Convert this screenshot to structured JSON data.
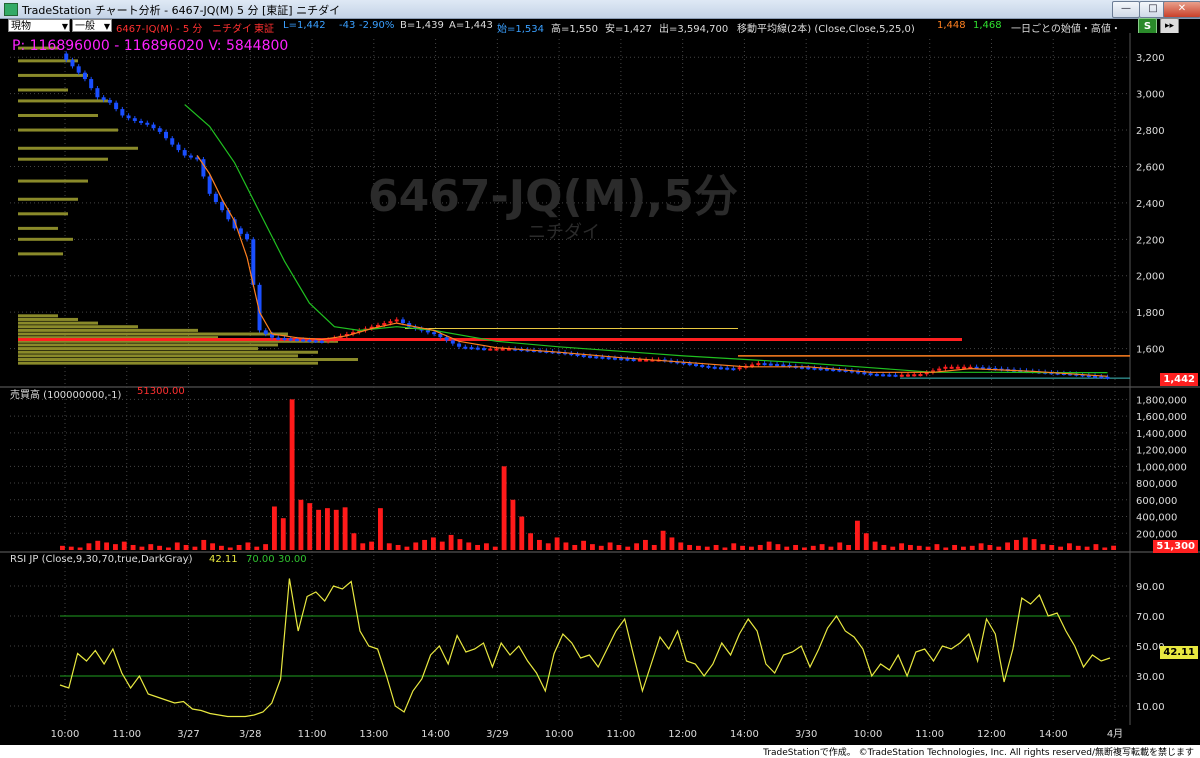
{
  "window": {
    "title": "TradeStation チャート分析 - 6467-JQ(M) 5 分 [東証] ニチダイ",
    "buttons": {
      "minimize": "—",
      "maximize": "□",
      "close": "✕"
    }
  },
  "toolbar": {
    "mode_select": "現物",
    "type_select": "一般",
    "symbol": "6467-JQ(M) - 5 分",
    "company": "ニチダイ",
    "exchange": "東証",
    "last_label": "L=1,442",
    "change": "-43",
    "change_pct": "-2.90%",
    "bid": "B=1,439",
    "ask": "A=1,443",
    "open": "始=1,534",
    "high": "高=1,550",
    "low": "安=1,427",
    "volume": "出=3,594,700",
    "ma_label": "移動平均線(2本) (Close,Close,5,25,0)",
    "ma_fast": "1,448",
    "ma_slow": "1,468",
    "extra": "一日ごとの始値・高値・オ"
  },
  "badges": {
    "s_badge": "S",
    "more_icon": "more-icon"
  },
  "main_panel": {
    "watermark_symbol": "6467-JQ(M),5分",
    "watermark_name": "ニチダイ",
    "cursor_info": "P: 116896000 - 116896020 V: 5844800",
    "last_price_tag": "1,442"
  },
  "volume_panel": {
    "label": "売買高 (100000000,-1)",
    "value": "51300.00",
    "last_value_tag": "51,300"
  },
  "rsi_panel": {
    "label": "RSI JP (Close,9,30,70,true,DarkGray)",
    "value": "42.11",
    "upper": "70.00",
    "lower": "30.00",
    "last_value_tag": "42.11"
  },
  "footer": {
    "copyright": "TradeStationで作成。 ©TradeStation Technologies, Inc. All rights reserved/無断複写転載を禁じます"
  },
  "colors": {
    "up": "#ff2020",
    "down": "#1a4fff",
    "ma_fast": "#ff8020",
    "ma_slow": "#20c020",
    "rsi": "#e8e840",
    "grid": "#444444",
    "volume_bar": "#ff1a1a",
    "volume_profile": "#8a8a2a"
  },
  "chart_data": [
    {
      "type": "candlestick",
      "title": "6467-JQ(M),5分",
      "ylim": [
        1400,
        3300
      ],
      "y_ticks": [
        1600,
        1800,
        2000,
        2200,
        2400,
        2600,
        2800,
        3000,
        3200
      ],
      "x_tick_labels": [
        "10:00",
        "11:00",
        "3/27",
        "3/28",
        "11:00",
        "13:00",
        "14:00",
        "3/29",
        "10:00",
        "11:00",
        "12:00",
        "14:00",
        "3/30",
        "10:00",
        "11:00",
        "12:00",
        "14:00",
        "4月"
      ],
      "close_path": [
        [
          0,
          3220
        ],
        [
          2,
          3150
        ],
        [
          4,
          3080
        ],
        [
          6,
          2980
        ],
        [
          8,
          2950
        ],
        [
          10,
          2880
        ],
        [
          12,
          2850
        ],
        [
          14,
          2830
        ],
        [
          16,
          2790
        ],
        [
          18,
          2720
        ],
        [
          20,
          2660
        ],
        [
          22,
          2640
        ],
        [
          24,
          2450
        ],
        [
          26,
          2360
        ],
        [
          28,
          2260
        ],
        [
          30,
          2200
        ],
        [
          32,
          1700
        ],
        [
          34,
          1660
        ],
        [
          38,
          1650
        ],
        [
          42,
          1640
        ],
        [
          46,
          1680
        ],
        [
          50,
          1720
        ],
        [
          54,
          1760
        ],
        [
          56,
          1720
        ],
        [
          60,
          1680
        ],
        [
          64,
          1610
        ],
        [
          68,
          1600
        ],
        [
          72,
          1600
        ],
        [
          76,
          1590
        ],
        [
          80,
          1580
        ],
        [
          84,
          1560
        ],
        [
          88,
          1550
        ],
        [
          92,
          1540
        ],
        [
          96,
          1540
        ],
        [
          100,
          1520
        ],
        [
          104,
          1500
        ],
        [
          108,
          1490
        ],
        [
          112,
          1520
        ],
        [
          116,
          1510
        ],
        [
          118,
          1500
        ],
        [
          122,
          1490
        ],
        [
          126,
          1480
        ],
        [
          130,
          1460
        ],
        [
          134,
          1455
        ],
        [
          138,
          1460
        ],
        [
          142,
          1500
        ],
        [
          146,
          1500
        ],
        [
          150,
          1490
        ],
        [
          154,
          1480
        ],
        [
          158,
          1470
        ],
        [
          162,
          1462
        ],
        [
          166,
          1448
        ],
        [
          168,
          1442
        ]
      ],
      "ma_fast_path": [
        [
          22,
          2660
        ],
        [
          24,
          2560
        ],
        [
          26,
          2420
        ],
        [
          28,
          2300
        ],
        [
          30,
          2100
        ],
        [
          32,
          1800
        ],
        [
          34,
          1680
        ],
        [
          38,
          1660
        ],
        [
          42,
          1650
        ],
        [
          46,
          1670
        ],
        [
          50,
          1710
        ],
        [
          54,
          1740
        ],
        [
          60,
          1700
        ],
        [
          64,
          1640
        ],
        [
          70,
          1605
        ],
        [
          80,
          1580
        ],
        [
          90,
          1550
        ],
        [
          100,
          1525
        ],
        [
          110,
          1500
        ],
        [
          120,
          1500
        ],
        [
          130,
          1470
        ],
        [
          140,
          1470
        ],
        [
          146,
          1490
        ],
        [
          156,
          1475
        ],
        [
          168,
          1448
        ]
      ],
      "ma_slow_path": [
        [
          20,
          2940
        ],
        [
          24,
          2820
        ],
        [
          28,
          2620
        ],
        [
          32,
          2350
        ],
        [
          36,
          2080
        ],
        [
          40,
          1850
        ],
        [
          44,
          1720
        ],
        [
          48,
          1700
        ],
        [
          54,
          1720
        ],
        [
          60,
          1700
        ],
        [
          70,
          1640
        ],
        [
          80,
          1610
        ],
        [
          90,
          1585
        ],
        [
          100,
          1560
        ],
        [
          110,
          1540
        ],
        [
          120,
          1520
        ],
        [
          130,
          1495
        ],
        [
          140,
          1470
        ],
        [
          150,
          1470
        ],
        [
          160,
          1468
        ],
        [
          168,
          1468
        ]
      ]
    },
    {
      "type": "bar",
      "title": "売買高",
      "ylim": [
        0,
        1900000
      ],
      "y_ticks": [
        200000,
        400000,
        600000,
        800000,
        1000000,
        1200000,
        1400000,
        1600000,
        1800000
      ],
      "values": [
        50000,
        40000,
        30000,
        80000,
        110000,
        90000,
        70000,
        100000,
        60000,
        40000,
        70000,
        50000,
        30000,
        90000,
        60000,
        40000,
        120000,
        80000,
        50000,
        30000,
        60000,
        90000,
        40000,
        70000,
        520000,
        380000,
        1800000,
        600000,
        560000,
        480000,
        500000,
        480000,
        510000,
        200000,
        80000,
        100000,
        500000,
        80000,
        60000,
        40000,
        90000,
        120000,
        150000,
        100000,
        180000,
        130000,
        90000,
        60000,
        80000,
        40000,
        1000000,
        600000,
        400000,
        200000,
        120000,
        80000,
        150000,
        90000,
        60000,
        110000,
        70000,
        50000,
        90000,
        60000,
        40000,
        80000,
        120000,
        60000,
        230000,
        150000,
        90000,
        60000,
        50000,
        40000,
        60000,
        30000,
        80000,
        50000,
        40000,
        60000,
        100000,
        70000,
        40000,
        60000,
        30000,
        50000,
        70000,
        40000,
        90000,
        60000,
        350000,
        200000,
        100000,
        60000,
        40000,
        80000,
        60000,
        50000,
        40000,
        70000,
        30000,
        60000,
        40000,
        50000,
        80000,
        60000,
        40000,
        90000,
        120000,
        150000,
        130000,
        70000,
        60000,
        40000,
        80000,
        50000,
        40000,
        70000,
        30000,
        51300
      ]
    },
    {
      "type": "line",
      "title": "RSI JP",
      "ylim": [
        0,
        100
      ],
      "y_ticks": [
        10,
        30,
        50,
        70,
        90
      ],
      "reference_lines": [
        30,
        70
      ],
      "values": [
        24,
        22,
        45,
        40,
        47,
        38,
        48,
        32,
        22,
        30,
        18,
        16,
        14,
        12,
        13,
        8,
        7,
        5,
        4,
        3,
        3,
        3,
        4,
        6,
        12,
        28,
        95,
        60,
        83,
        86,
        80,
        90,
        88,
        93,
        60,
        50,
        48,
        30,
        10,
        6,
        20,
        28,
        44,
        50,
        38,
        57,
        46,
        48,
        52,
        36,
        52,
        44,
        50,
        40,
        32,
        20,
        45,
        58,
        52,
        42,
        44,
        36,
        48,
        60,
        68,
        44,
        20,
        38,
        56,
        48,
        60,
        40,
        38,
        30,
        38,
        52,
        44,
        58,
        68,
        60,
        38,
        32,
        44,
        46,
        50,
        36,
        48,
        62,
        70,
        60,
        56,
        48,
        30,
        38,
        34,
        44,
        30,
        46,
        48,
        40,
        50,
        48,
        52,
        58,
        40,
        68,
        58,
        26,
        48,
        82,
        78,
        84,
        70,
        72,
        60,
        50,
        36,
        44,
        40,
        42
      ]
    }
  ]
}
